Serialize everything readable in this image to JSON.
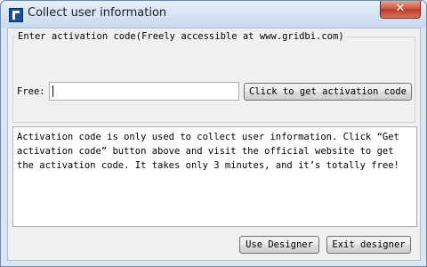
{
  "window": {
    "title": "Collect user information",
    "close_glyph": "✕"
  },
  "activation": {
    "group_label": "Enter activation code(Freely accessible at www.gridbi.com)",
    "free_label": "Free:",
    "free_value": "",
    "get_code_button": "Click to get activation code"
  },
  "message": {
    "text": "Activation code is only used to collect user information. Click “Get activation code” button above and visit the official website to get the activation code. It takes only 3 minutes, and it’s totally free!"
  },
  "footer": {
    "use_designer_button": "Use Designer",
    "exit_designer_button": "Exit designer"
  },
  "colors": {
    "titlebar": "#c9d9ee",
    "close_button": "#c7503a",
    "client_background": "#f0f0f0"
  },
  "icons": {
    "app": "app-logo-icon",
    "close": "close-icon"
  }
}
